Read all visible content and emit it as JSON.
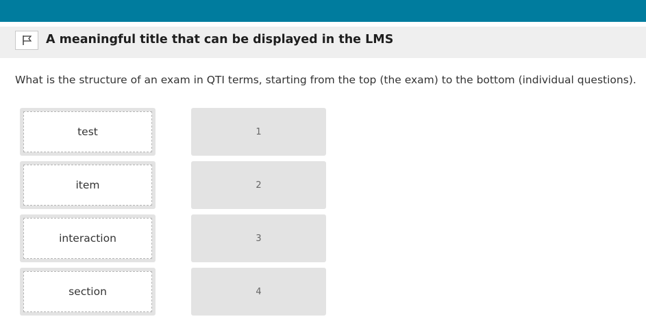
{
  "header": {
    "title": "A meaningful title that can be displayed in the LMS",
    "flag_icon": "flag-icon"
  },
  "question": {
    "prompt": "What is the structure of an exam in QTI terms, starting from the top (the exam) to the bottom (individual questions)."
  },
  "choices": [
    {
      "label": "test"
    },
    {
      "label": "item"
    },
    {
      "label": "interaction"
    },
    {
      "label": "section"
    }
  ],
  "slots": [
    {
      "label": "1"
    },
    {
      "label": "2"
    },
    {
      "label": "3"
    },
    {
      "label": "4"
    }
  ],
  "colors": {
    "topbar": "#007c9e",
    "titlebar": "#efefef",
    "slot": "#e3e3e3"
  }
}
